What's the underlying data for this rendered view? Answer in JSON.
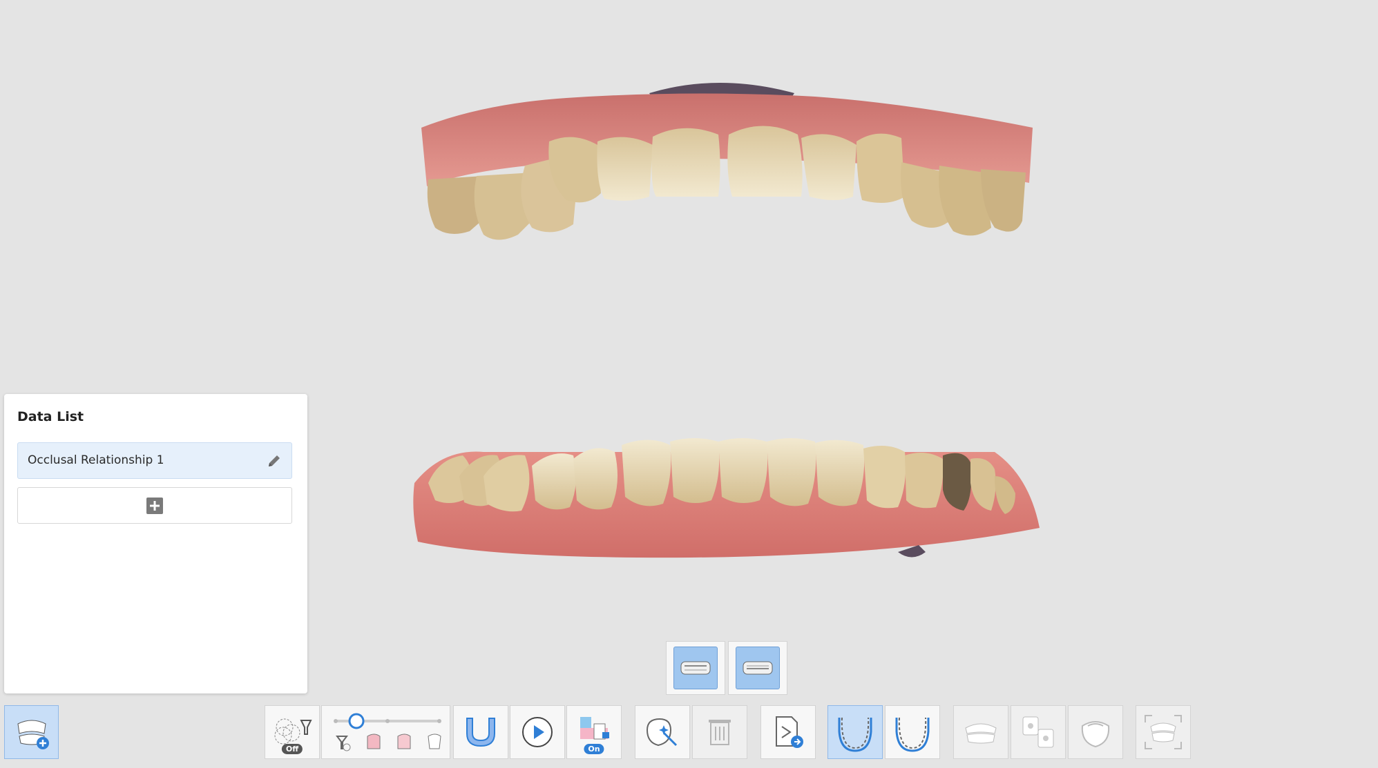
{
  "panel": {
    "title": "Data List",
    "items": [
      {
        "label": "Occlusal Relationship 1"
      }
    ]
  },
  "toolbar": {
    "filter_toggle_state": "Off",
    "texture_lock_state": "On",
    "smart_scan_slider_value": 0.2
  },
  "colors": {
    "accent": "#2f7fd6",
    "active_bg": "#c8def7",
    "panel_item_bg": "#e6f0fb",
    "background": "#e4e4e4",
    "gum": "#e08f8a",
    "tooth": "#e9dcbc"
  },
  "icons": [
    "add-data-icon",
    "edit-icon",
    "plus-icon",
    "filter-icon",
    "smart-scan-slider",
    "arch-icon",
    "play-icon",
    "lock-texture-icon",
    "ai-tooth-icon",
    "trash-icon",
    "export-icon",
    "maxilla-arch-icon",
    "mandible-arch-icon",
    "occlusion-icon",
    "align-icon",
    "bite-icon",
    "fit-view-icon"
  ]
}
